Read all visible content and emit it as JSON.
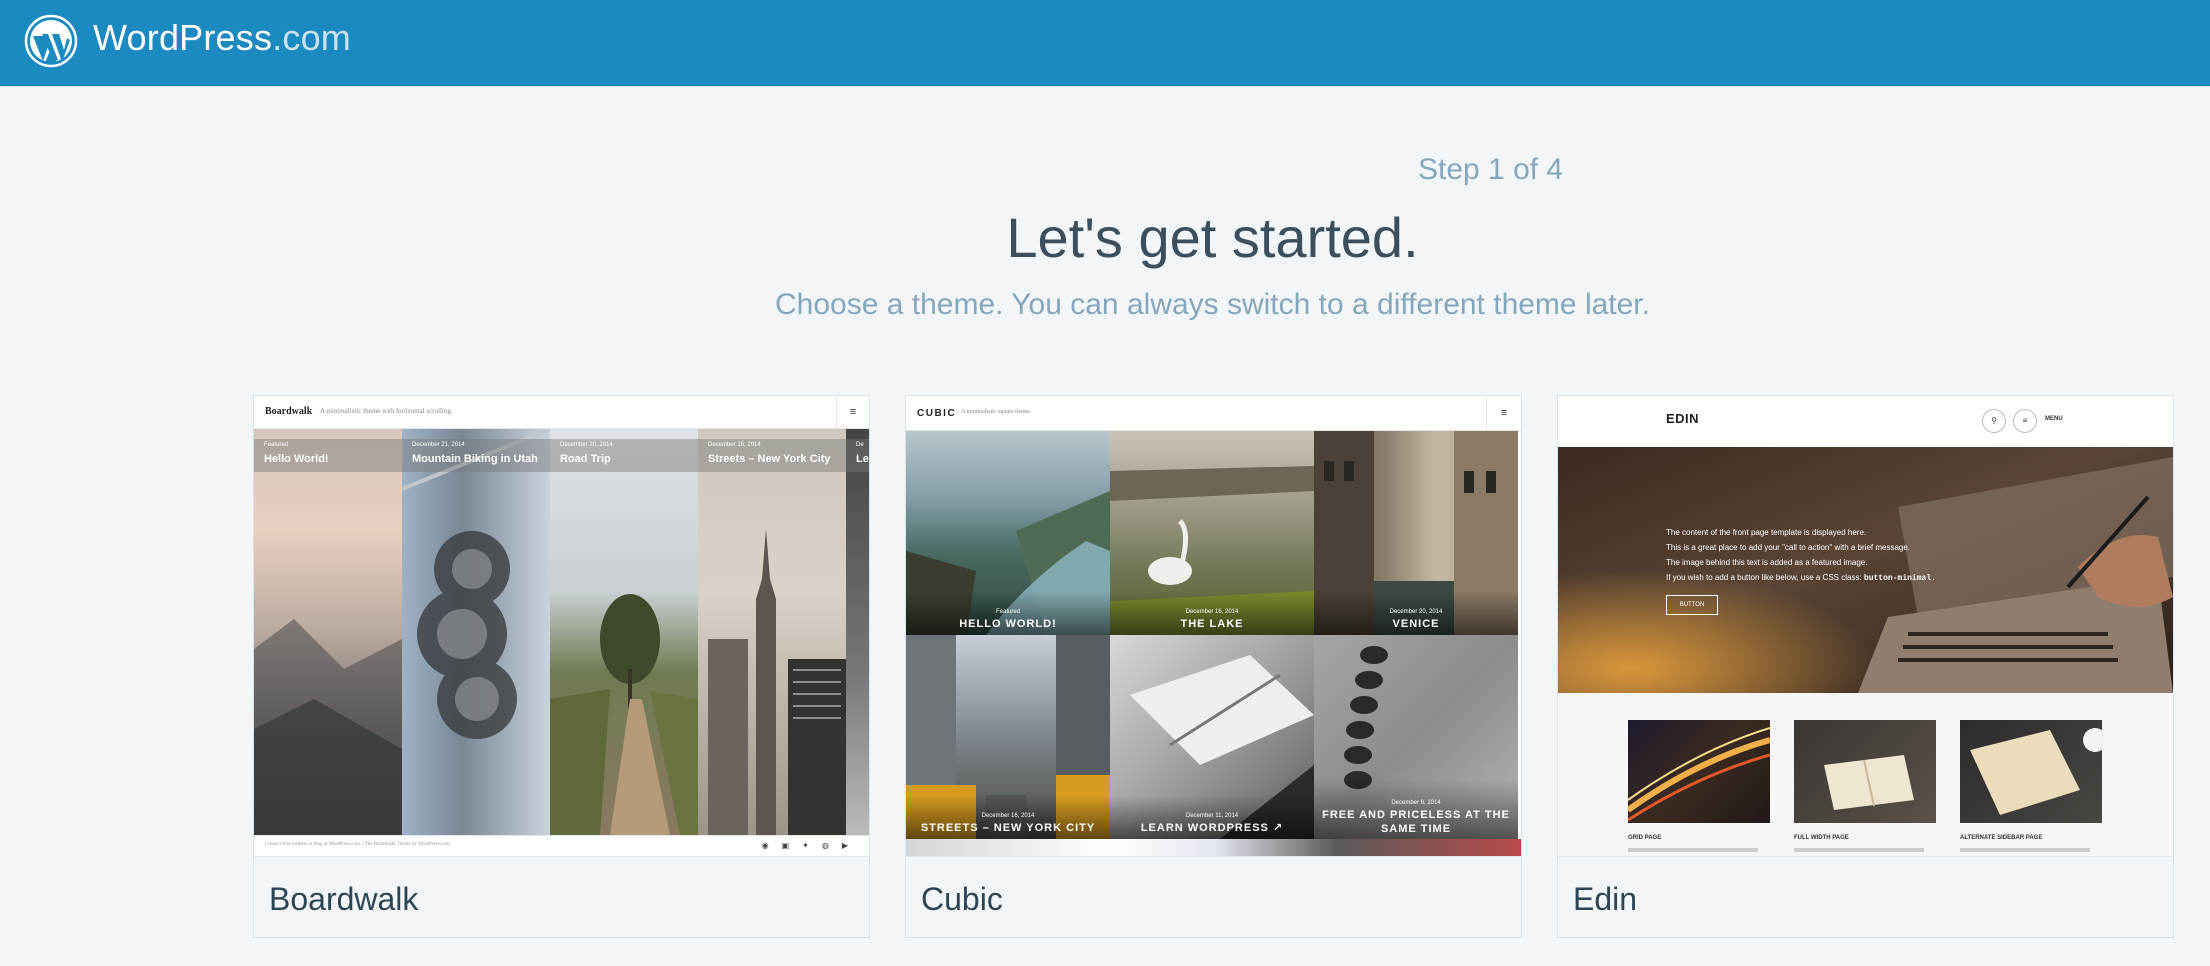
{
  "masterbar": {
    "brand_name": "WordPress",
    "brand_suffix": ".com",
    "bg_color": "#1a8ac1",
    "logo_icon": "wordpress-logo-icon"
  },
  "header": {
    "step": "Step 1 of 4",
    "title": "Let's get started.",
    "subtitle": "Choose a theme. You can always switch to a different theme later."
  },
  "themes": [
    {
      "name": "Boardwalk",
      "preview": {
        "site_title": "Boardwalk",
        "tagline": "A minimalistic theme with horizontal scrolling.",
        "posts": [
          {
            "date": "Featured",
            "title": "Hello World!"
          },
          {
            "date": "December 21, 2014",
            "title": "Mountain Biking in Utah"
          },
          {
            "date": "December 20, 2014",
            "title": "Road Trip"
          },
          {
            "date": "December 16, 2014",
            "title": "Streets – New York City"
          },
          {
            "date": "De",
            "title": "Le"
          }
        ],
        "footer": "Create a free website or blog at WordPress.com. | The Boardwalk Theme by WordPress.com."
      }
    },
    {
      "name": "Cubic",
      "preview": {
        "site_title": "CUBIC",
        "tagline": "A minimalistic square theme.",
        "posts": [
          {
            "date": "Featured",
            "title": "HELLO WORLD!"
          },
          {
            "date": "December 16, 2014",
            "title": "THE LAKE"
          },
          {
            "date": "December 20, 2014",
            "title": "VENICE"
          },
          {
            "date": "December 16, 2014",
            "title": "STREETS – NEW YORK CITY"
          },
          {
            "date": "December 11, 2014",
            "title": "LEARN WORDPRESS ↗"
          },
          {
            "date": "December 8, 2014",
            "title": "FREE AND PRICELESS AT THE SAME TIME"
          }
        ]
      }
    },
    {
      "name": "Edin",
      "preview": {
        "site_title": "EDIN",
        "menu": "MENU",
        "hero_lines": [
          "The content of the front page template is displayed here.",
          "This is a great place to add your \"call to action\" with a brief message.",
          "The image behind this text is added as a featured image.",
          "If you wish to add a button like below, use a CSS class:"
        ],
        "hero_code": "button-minimal.",
        "hero_button": "BUTTON",
        "pages": [
          "GRID PAGE",
          "FULL WIDTH PAGE",
          "ALTERNATE SIDEBAR PAGE"
        ]
      }
    }
  ]
}
